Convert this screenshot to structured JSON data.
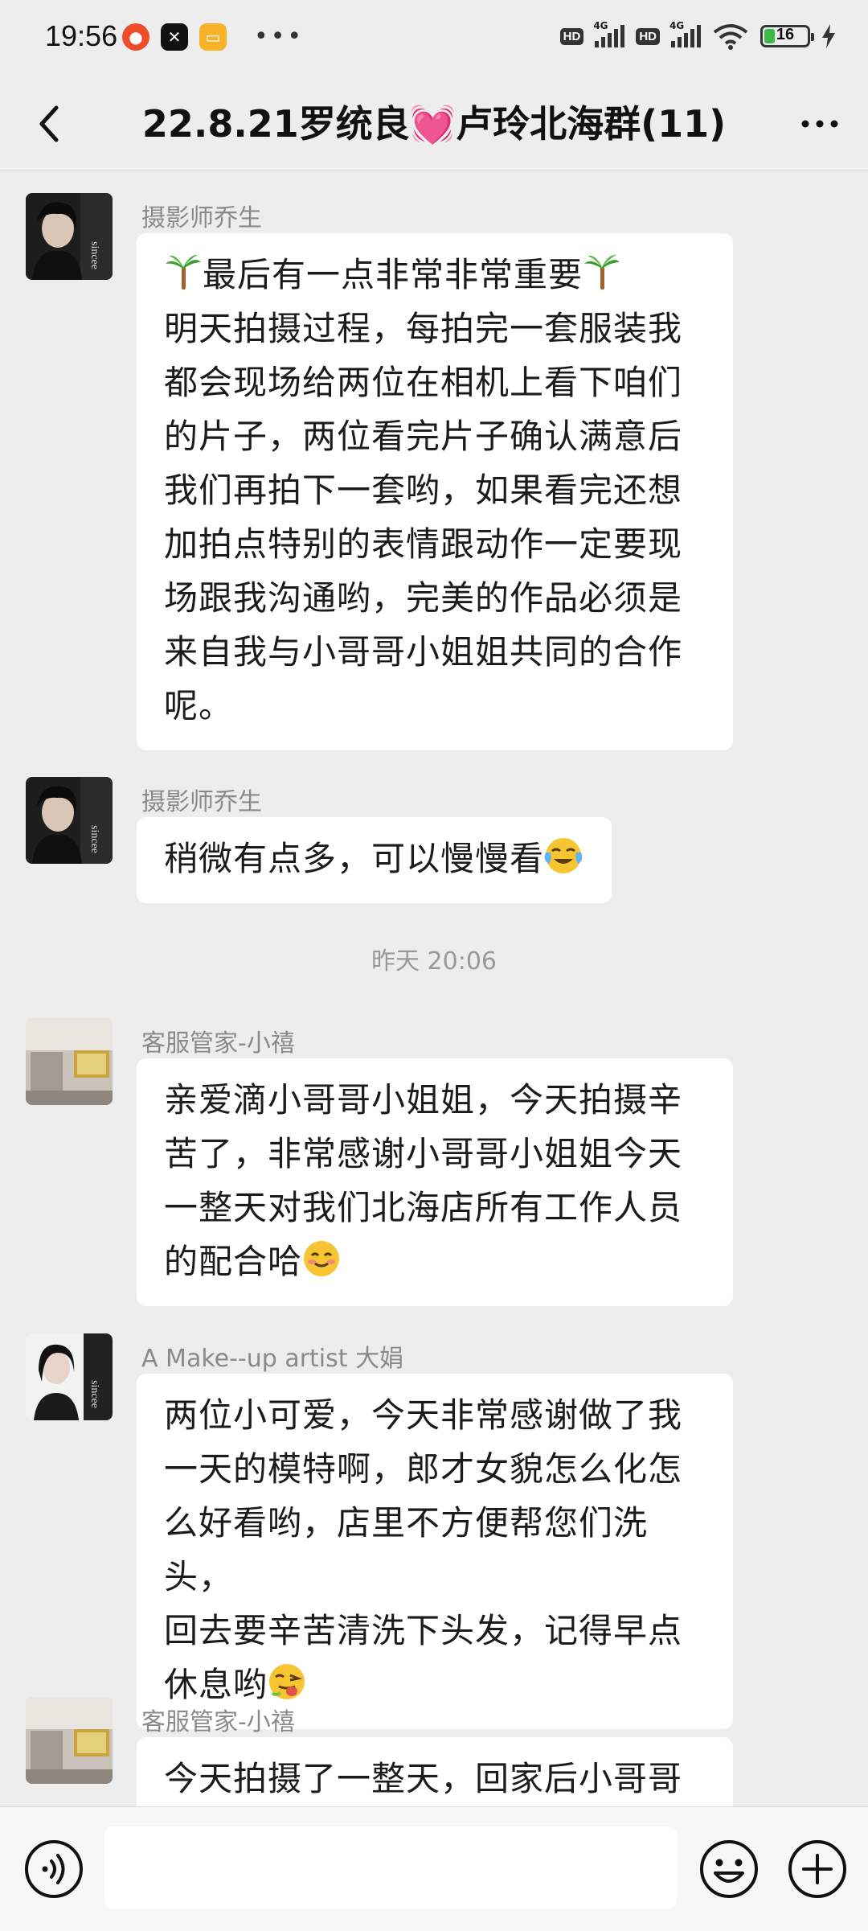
{
  "status_bar": {
    "time": "19:56",
    "hd1": "HD",
    "net1": "4G",
    "hd2": "HD",
    "net2": "4G",
    "battery_level": "16"
  },
  "header": {
    "title": "22.8.21罗统良💓卢玲北海群(11)"
  },
  "messages": [
    {
      "sender": "摄影师乔生",
      "text_lines": [
        "最后有一点非常非常重要",
        "明天拍摄过程，每拍完一套服装我",
        "都会现场给两位在相机上看下咱们",
        "的片子，两位看完片子确认满意后",
        "我们再拍下一套哟，如果看完还想",
        "加拍点特别的表情跟动作一定要现",
        "场跟我沟通哟，完美的作品必须是",
        "来自我与小哥哥小姐姐共同的合作",
        "呢。"
      ]
    },
    {
      "sender": "摄影师乔生",
      "text": "稍微有点多，可以慢慢看"
    },
    {
      "timestamp": "昨天 20:06"
    },
    {
      "sender": "客服管家-小禧",
      "text_lines": [
        "亲爱滴小哥哥小姐姐，今天拍摄辛",
        "苦了，非常感谢小哥哥小姐姐今天",
        "一整天对我们北海店所有工作人员",
        "的配合哈"
      ]
    },
    {
      "sender": "A  Make--up artist 大娟",
      "text_lines": [
        "两位小可爱，今天非常感谢做了我",
        "一天的模特啊，郎才女貌怎么化怎",
        "么好看哟，店里不方便帮您们洗头，",
        "回去要辛苦清洗下头发，记得早点",
        "休息哟"
      ]
    },
    {
      "sender": "客服管家-小禧",
      "text_lines": [
        "今天拍摄了一整天，回家后小哥哥"
      ]
    }
  ],
  "input_bar": {
    "value": ""
  }
}
